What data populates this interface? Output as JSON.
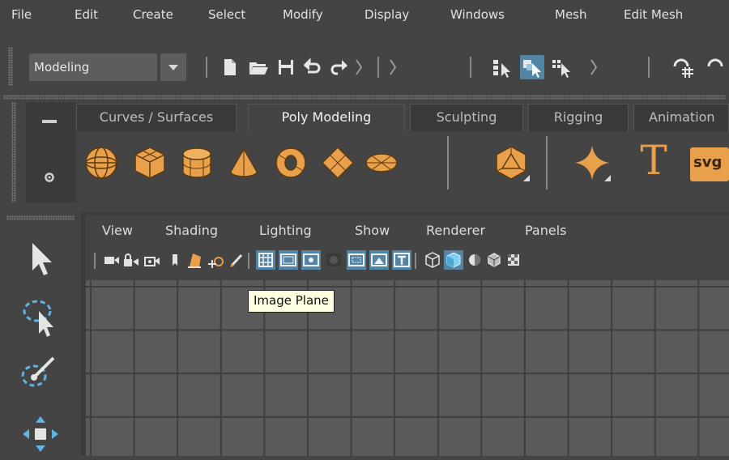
{
  "menubar": {
    "items": [
      "File",
      "Edit",
      "Create",
      "Select",
      "Modify",
      "Display",
      "Windows",
      "Mesh",
      "Edit Mesh"
    ]
  },
  "statusline": {
    "mode": "Modeling",
    "tool_icons": [
      "new-scene-icon",
      "open-scene-icon",
      "save-scene-icon",
      "undo-icon",
      "redo-icon",
      "select-by-hierarchy-icon",
      "select-by-object-icon",
      "select-by-component-icon",
      "snap-to-grid-icon"
    ]
  },
  "shelf": {
    "tabs": [
      "Curves / Surfaces",
      "Poly Modeling",
      "Sculpting",
      "Rigging",
      "Animation"
    ],
    "active_tab": "Poly Modeling",
    "svg_label": "svg",
    "text_label": "T",
    "accent_color": "#e8a04a"
  },
  "panel": {
    "menus": [
      "View",
      "Shading",
      "Lighting",
      "Show",
      "Renderer",
      "Panels"
    ]
  },
  "tooltip": {
    "text": "Image Plane"
  },
  "colors": {
    "background": "#444444",
    "active_blue": "#5285a6",
    "viewport": "#5a5a5a",
    "accent_orange": "#e8a04a"
  }
}
